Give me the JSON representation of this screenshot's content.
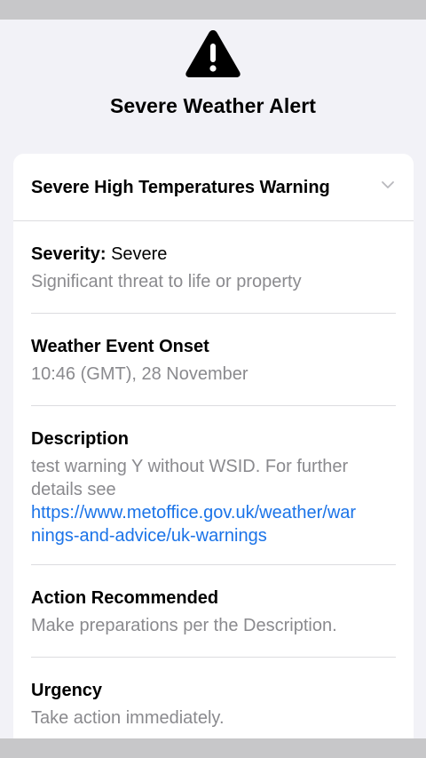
{
  "alert": {
    "title": "Severe Weather Alert",
    "icon": "warning-triangle-icon"
  },
  "card": {
    "warning_title": "Severe High Temperatures Warning",
    "sections": {
      "severity": {
        "label": "Severity:",
        "value": "Severe",
        "detail": "Significant threat to life or property"
      },
      "onset": {
        "label": "Weather Event Onset",
        "detail": "10:46 (GMT), 28 November"
      },
      "description": {
        "label": "Description",
        "detail": "test warning Y without WSID. For further details see",
        "link_line1": "https://www.metoffice.gov.uk/weather/war",
        "link_line2": "nings-and-advice/uk-warnings"
      },
      "action": {
        "label": "Action Recommended",
        "detail": "Make preparations per the Description."
      },
      "urgency": {
        "label": "Urgency",
        "detail": "Take action immediately."
      }
    }
  },
  "colors": {
    "background": "#f2f2f7",
    "card": "#ffffff",
    "secondary_text": "#8a8a8e",
    "link": "#1a73e8",
    "divider": "#dcdce0"
  }
}
